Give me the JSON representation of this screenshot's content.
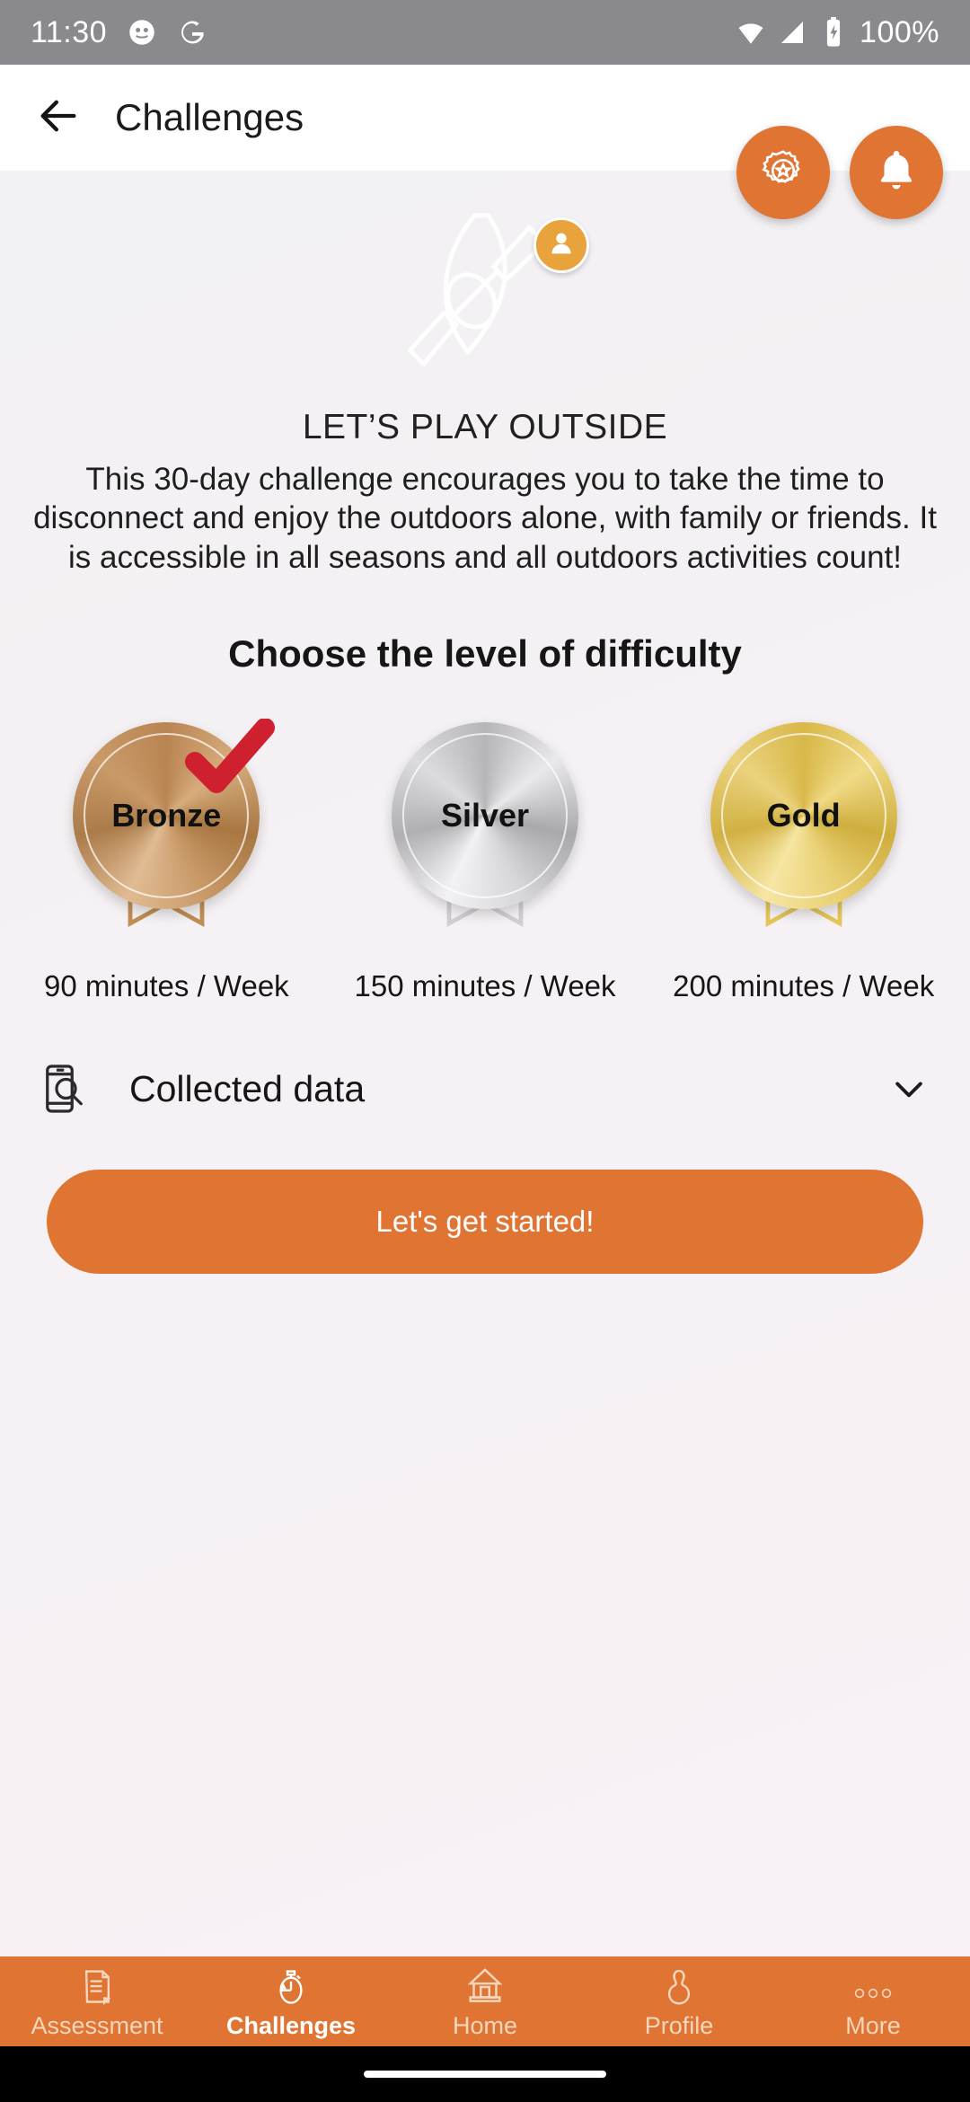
{
  "statusbar": {
    "time": "11:30",
    "battery_text": "100%",
    "icons": [
      "app-icon",
      "google-icon",
      "wifi-icon",
      "signal-icon",
      "battery-charging-icon"
    ]
  },
  "appbar": {
    "title": "Challenges",
    "back_icon": "back-arrow-icon"
  },
  "fabs": [
    {
      "name": "achievements-fab",
      "icon": "award-badge-icon"
    },
    {
      "name": "notifications-fab",
      "icon": "bell-icon"
    }
  ],
  "hero": {
    "illustration": "kayak-paddle-icon",
    "avatar_icon": "person-icon"
  },
  "challenge": {
    "title": "LET’S PLAY OUTSIDE",
    "description": "This 30-day challenge encourages you to take the time to disconnect and enjoy the outdoors alone, with family or friends. It is accessible in all seasons and all outdoors activities count!"
  },
  "difficulty": {
    "heading": "Choose the level of difficulty",
    "levels": [
      {
        "label": "Bronze",
        "duration": "90 minutes / Week",
        "selected": true
      },
      {
        "label": "Silver",
        "duration": "150 minutes / Week",
        "selected": false
      },
      {
        "label": "Gold",
        "duration": "200 minutes / Week",
        "selected": false
      }
    ]
  },
  "collected_data": {
    "label": "Collected data",
    "icon": "phone-search-icon",
    "expand_icon": "chevron-down-icon"
  },
  "cta": {
    "label": "Let's get started!"
  },
  "bottomnav": {
    "items": [
      {
        "label": "Assessment",
        "icon": "document-icon",
        "active": false
      },
      {
        "label": "Challenges",
        "icon": "stopwatch-icon",
        "active": true
      },
      {
        "label": "Home",
        "icon": "house-icon",
        "active": false
      },
      {
        "label": "Profile",
        "icon": "person-outline-icon",
        "active": false
      },
      {
        "label": "More",
        "icon": "three-dots-icon",
        "active": false
      }
    ]
  },
  "colors": {
    "accent": "#df7433",
    "statusbar": "#8a8a8e",
    "background": "#f4f1f4",
    "avatar": "#e8a33d",
    "check": "#cf2030"
  }
}
